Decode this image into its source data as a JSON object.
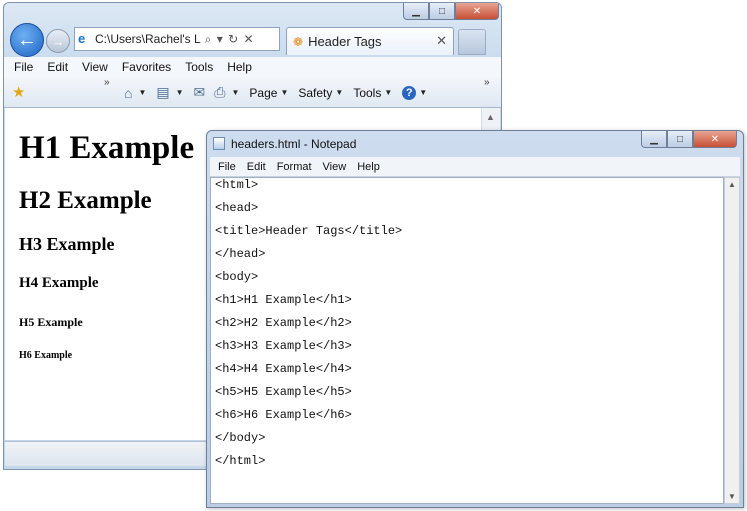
{
  "browser": {
    "address": "C:\\Users\\Rachel's L",
    "address_tools": "⌕ ▾ ↻ ✕",
    "tab_title": "Header Tags",
    "tab_close": "✕",
    "back_glyph": "←",
    "forward_glyph": "→",
    "menu": [
      "File",
      "Edit",
      "View",
      "Favorites",
      "Tools",
      "Help"
    ],
    "toolbar": {
      "page": "Page",
      "safety": "Safety",
      "tools": "Tools",
      "help_glyph": "?"
    },
    "content": {
      "h1": "H1 Example",
      "h2": "H2 Example",
      "h3": "H3 Example",
      "h4": "H4 Example",
      "h5": "H5 Example",
      "h6": "H6 Example"
    }
  },
  "notepad": {
    "title": "headers.html - Notepad",
    "menu": [
      "File",
      "Edit",
      "Format",
      "View",
      "Help"
    ],
    "lines": [
      "<html>",
      "<head>",
      "<title>Header Tags</title>",
      "</head>",
      "<body>",
      "<h1>H1 Example</h1>",
      "<h2>H2 Example</h2>",
      "<h3>H3 Example</h3>",
      "<h4>H4 Example</h4>",
      "<h5>H5 Example</h5>",
      "<h6>H6 Example</h6>",
      "</body>",
      "</html>"
    ]
  },
  "icons": {
    "minimize": "▁",
    "maximize": "□",
    "close": "✕"
  }
}
